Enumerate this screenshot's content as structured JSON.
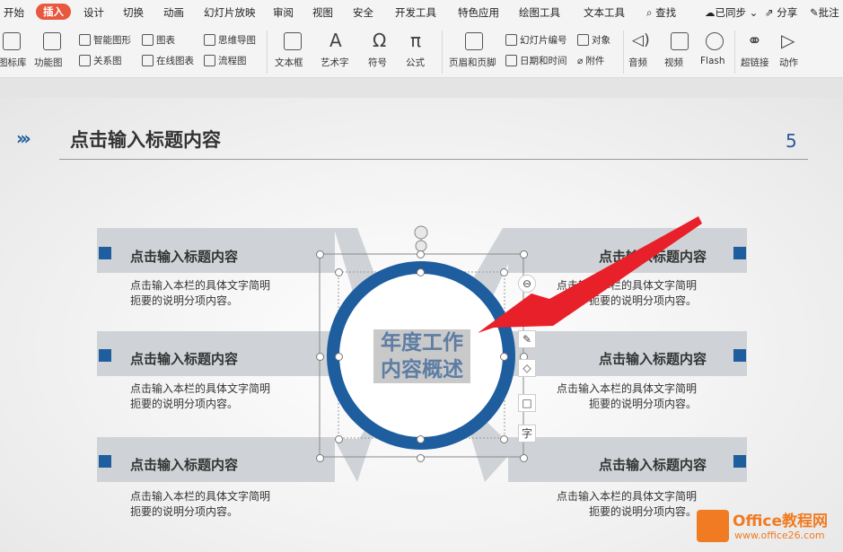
{
  "menu": {
    "items": [
      "开始",
      "插入",
      "设计",
      "切换",
      "动画",
      "幻灯片放映",
      "审阅",
      "视图",
      "安全",
      "开发工具",
      "特色应用",
      "绘图工具",
      "文本工具"
    ],
    "search": "查找",
    "sync": "已同步",
    "share": "分享",
    "comment": "批注"
  },
  "ribbon": {
    "library": "图标库",
    "function_chart": "功能图",
    "smart_shape": "智能图形",
    "chart": "图表",
    "mind_map": "思维导图",
    "relation_chart": "关系图",
    "online_chart": "在线图表",
    "flowchart": "流程图",
    "textbox": "文本框",
    "art_text": "艺术字",
    "symbol": "符号",
    "formula": "公式",
    "header_footer": "页眉和页脚",
    "slide_number": "幻灯片编号",
    "object": "对象",
    "date_time": "日期和时间",
    "attachment": "附件",
    "audio": "音频",
    "video": "视频",
    "flash": "Flash",
    "hyperlink": "超链接",
    "action": "动作"
  },
  "slide": {
    "title": "点击输入标题内容",
    "page_number": "5",
    "center_line1": "年度工作",
    "center_line2": "内容概述",
    "items": [
      {
        "title": "点击输入标题内容",
        "desc1": "点击输入本栏的具体文字简明",
        "desc2": "扼要的说明分项内容。"
      },
      {
        "title": "点击输入标题内容",
        "desc1": "点击输入本栏的具体文字简明",
        "desc2": "扼要的说明分项内容。"
      },
      {
        "title": "点击输入标题内容",
        "desc1": "点击输入本栏的具体文字简明",
        "desc2": "扼要的说明分项内容。"
      },
      {
        "title": "点击输入标题内容",
        "desc1": "点击输入本栏的具体文字简明",
        "desc2": "扼要的说明分项内容。"
      },
      {
        "title": "点击输入标题内容",
        "desc1": "点击输入本栏的具体文字简明",
        "desc2": "扼要的说明分项内容。"
      },
      {
        "title": "点击输入标题内容",
        "desc1": "点击输入本栏的具体文字简明",
        "desc2": "扼要的说明分项内容。"
      }
    ],
    "side_tools": [
      "⊖",
      "✎",
      "◇",
      "□",
      "字"
    ]
  },
  "watermark": {
    "brand": "Office教程网",
    "url": "www.office26.com"
  },
  "colors": {
    "accent_orange": "#e8573e",
    "ring_blue": "#1e5d9e",
    "arrow_red": "#e8202a"
  }
}
